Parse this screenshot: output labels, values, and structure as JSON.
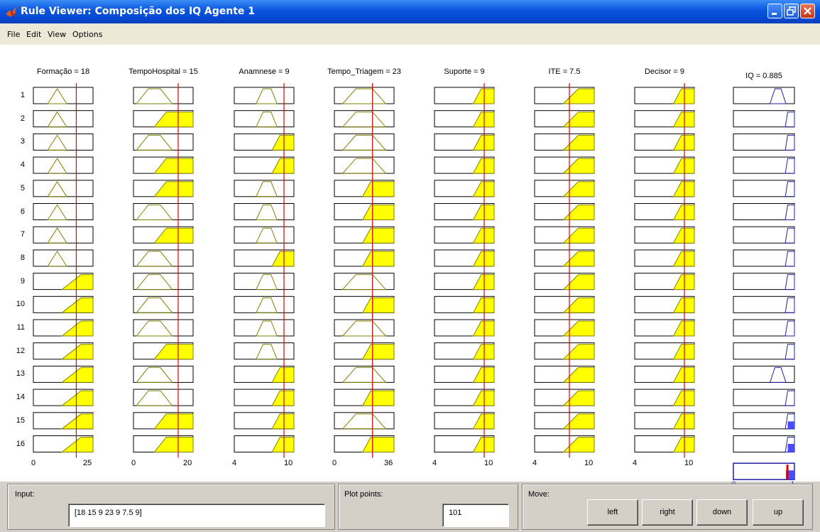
{
  "window": {
    "title": "Rule Viewer: Composição dos IQ Agente 1",
    "icon": "matlab-icon",
    "controls": [
      "minimize-icon",
      "restore-icon",
      "close-icon"
    ]
  },
  "menu": [
    "File",
    "Edit",
    "View",
    "Options"
  ],
  "inputs": [
    {
      "label": "Formação = 18",
      "min": "0",
      "max": "25",
      "value": 18,
      "range": [
        0,
        25
      ],
      "mfs": {
        "tri": [
          6,
          10,
          14
        ],
        "high": [
          12,
          20,
          25,
          25
        ]
      },
      "rules": [
        "tri",
        "tri",
        "tri",
        "tri",
        "tri",
        "tri",
        "tri",
        "tri",
        "high",
        "high",
        "high",
        "high",
        "high",
        "high",
        "high",
        "high"
      ]
    },
    {
      "label": "TempoHospital = 15",
      "min": "0",
      "max": "20",
      "value": 15,
      "range": [
        0,
        20
      ],
      "mfs": {
        "trap": [
          1,
          5,
          9,
          13
        ],
        "high": [
          7,
          11,
          20,
          20
        ]
      },
      "rules": [
        "trap",
        "high",
        "trap",
        "high",
        "high",
        "trap",
        "high",
        "trap",
        "trap",
        "trap",
        "trap",
        "high",
        "trap",
        "trap",
        "high",
        "high"
      ]
    },
    {
      "label": "Anamnese = 9",
      "min": "4",
      "max": "10",
      "value": 9,
      "range": [
        4,
        10
      ],
      "mfs": {
        "trap": [
          6.2,
          6.9,
          7.7,
          8.3
        ],
        "high": [
          7.8,
          8.6,
          10,
          10
        ]
      },
      "rules": [
        "trap",
        "trap",
        "high",
        "high",
        "trap",
        "trap",
        "trap",
        "high",
        "trap",
        "trap",
        "trap",
        "trap",
        "high",
        "high",
        "high",
        "high"
      ]
    },
    {
      "label": "Tempo_Triagem = 23",
      "min": "0",
      "max": "36",
      "value": 23,
      "range": [
        0,
        36
      ],
      "mfs": {
        "trap": [
          5,
          13,
          23,
          31
        ],
        "high": [
          17,
          22,
          36,
          36
        ]
      },
      "rules": [
        "trap",
        "trap",
        "trap",
        "trap",
        "high",
        "high",
        "high",
        "high",
        "trap",
        "high",
        "trap",
        "high",
        "trap",
        "high",
        "trap",
        "high"
      ]
    },
    {
      "label": "Suporte = 9",
      "min": "4",
      "max": "10",
      "value": 9,
      "range": [
        4,
        10
      ],
      "mfs": {
        "high": [
          7.9,
          8.7,
          10,
          10
        ]
      },
      "rules": [
        "high",
        "high",
        "high",
        "high",
        "high",
        "high",
        "high",
        "high",
        "high",
        "high",
        "high",
        "high",
        "high",
        "high",
        "high",
        "high"
      ]
    },
    {
      "label": "ITE = 7.5",
      "min": "4",
      "max": "10",
      "value": 7.5,
      "range": [
        4,
        10
      ],
      "mfs": {
        "high": [
          6.9,
          8.4,
          10,
          10
        ]
      },
      "rules": [
        "high",
        "high",
        "high",
        "high",
        "high",
        "high",
        "high",
        "high",
        "high",
        "high",
        "high",
        "high",
        "high",
        "high",
        "high",
        "high"
      ]
    },
    {
      "label": "Decisor = 9",
      "min": "4",
      "max": "10",
      "value": 9,
      "range": [
        4,
        10
      ],
      "mfs": {
        "high": [
          7.9,
          8.7,
          10,
          10
        ]
      },
      "rules": [
        "high",
        "high",
        "high",
        "high",
        "high",
        "high",
        "high",
        "high",
        "high",
        "high",
        "high",
        "high",
        "high",
        "high",
        "high",
        "high"
      ]
    }
  ],
  "output": {
    "label": "IQ = 0.885",
    "min": "0",
    "max": "1",
    "value": 0.885,
    "range": [
      0,
      1
    ],
    "mfs": {
      "trap": [
        0.6,
        0.68,
        0.78,
        0.86
      ],
      "high": [
        0.85,
        0.89,
        1,
        1
      ]
    },
    "rules": [
      "trap",
      "high",
      "high",
      "high",
      "high",
      "high",
      "high",
      "high",
      "high",
      "high",
      "high",
      "high",
      "trap",
      "high",
      "high",
      "high"
    ],
    "filled_rules": [
      15,
      16
    ]
  },
  "rule_numbers": [
    "1",
    "2",
    "3",
    "4",
    "5",
    "6",
    "7",
    "8",
    "9",
    "10",
    "11",
    "12",
    "13",
    "14",
    "15",
    "16"
  ],
  "colors": {
    "mf_fill": "#ffff00",
    "mf_line": "#808000",
    "value_line": "#e00000",
    "output_line": "#1f1fa0",
    "output_fill": "#4a4aff"
  },
  "controls": {
    "input_label": "Input:",
    "input_value": "[18 15 9 23 9 7.5 9]",
    "plot_points_label": "Plot points:",
    "plot_points_value": "101",
    "move_label": "Move:",
    "move_buttons": [
      "left",
      "right",
      "down",
      "up"
    ]
  }
}
